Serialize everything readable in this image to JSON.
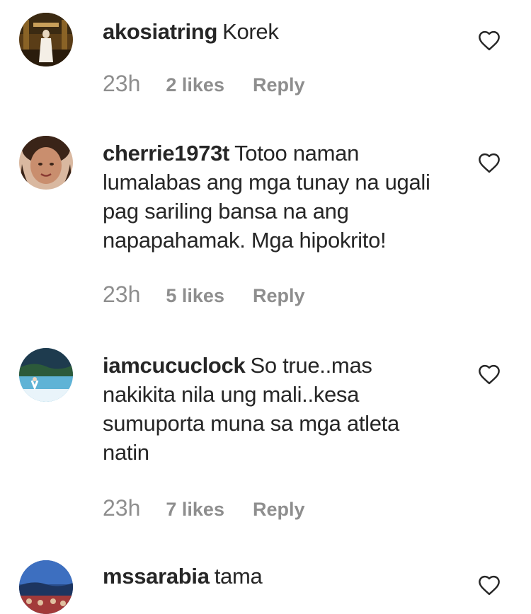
{
  "comments": [
    {
      "username": "akosiatring",
      "text": "Korek",
      "time": "23h",
      "likes": "2 likes",
      "reply": "Reply",
      "avatar_color": "#6b4a1e",
      "heart_icon": "heart-outline-icon"
    },
    {
      "username": "cherrie1973t",
      "text": "Totoo naman lumalabas ang mga tunay na ugali pag sariling bansa na ang napapahamak. Mga hipokrito!",
      "time": "23h",
      "likes": "5 likes",
      "reply": "Reply",
      "avatar_color": "#a0624a",
      "heart_icon": "heart-outline-icon"
    },
    {
      "username": "iamcucuclock",
      "text": "So true..mas nakikita nila ung mali..kesa sumuporta muna sa mga atleta natin",
      "time": "23h",
      "likes": "7 likes",
      "reply": "Reply",
      "avatar_color": "#2e6f8e",
      "heart_icon": "heart-outline-icon"
    },
    {
      "username": "mssarabia",
      "text": "tama",
      "time": "",
      "likes": "",
      "reply": "",
      "avatar_color": "#2a4f8f",
      "heart_icon": "heart-outline-icon"
    }
  ]
}
